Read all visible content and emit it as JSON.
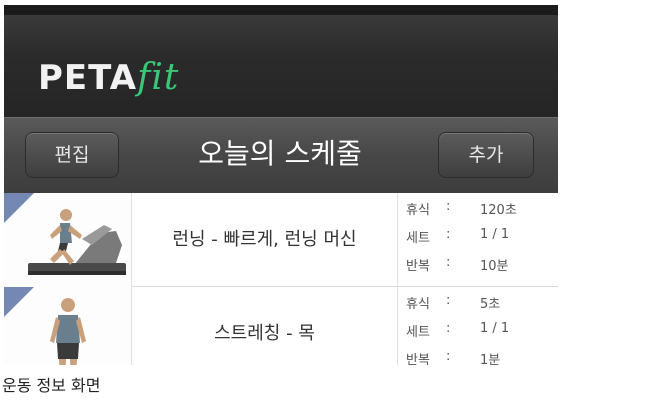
{
  "app": {
    "logo_main": "PETA",
    "logo_accent": "fit"
  },
  "titlebar": {
    "edit_label": "편집",
    "title": "오늘의 스케줄",
    "add_label": "추가"
  },
  "schedule": [
    {
      "name": "런닝 - 빠르게, 런닝 머신",
      "stats": [
        {
          "key": "휴식",
          "value": "120초"
        },
        {
          "key": "세트",
          "value": "1 / 1"
        },
        {
          "key": "반복",
          "value": "10분"
        }
      ]
    },
    {
      "name": "스트레칭 - 목",
      "stats": [
        {
          "key": "휴식",
          "value": "5초"
        },
        {
          "key": "세트",
          "value": "1 / 1"
        },
        {
          "key": "반복",
          "value": "1분"
        }
      ]
    }
  ],
  "caption": "운동 정보 화면"
}
